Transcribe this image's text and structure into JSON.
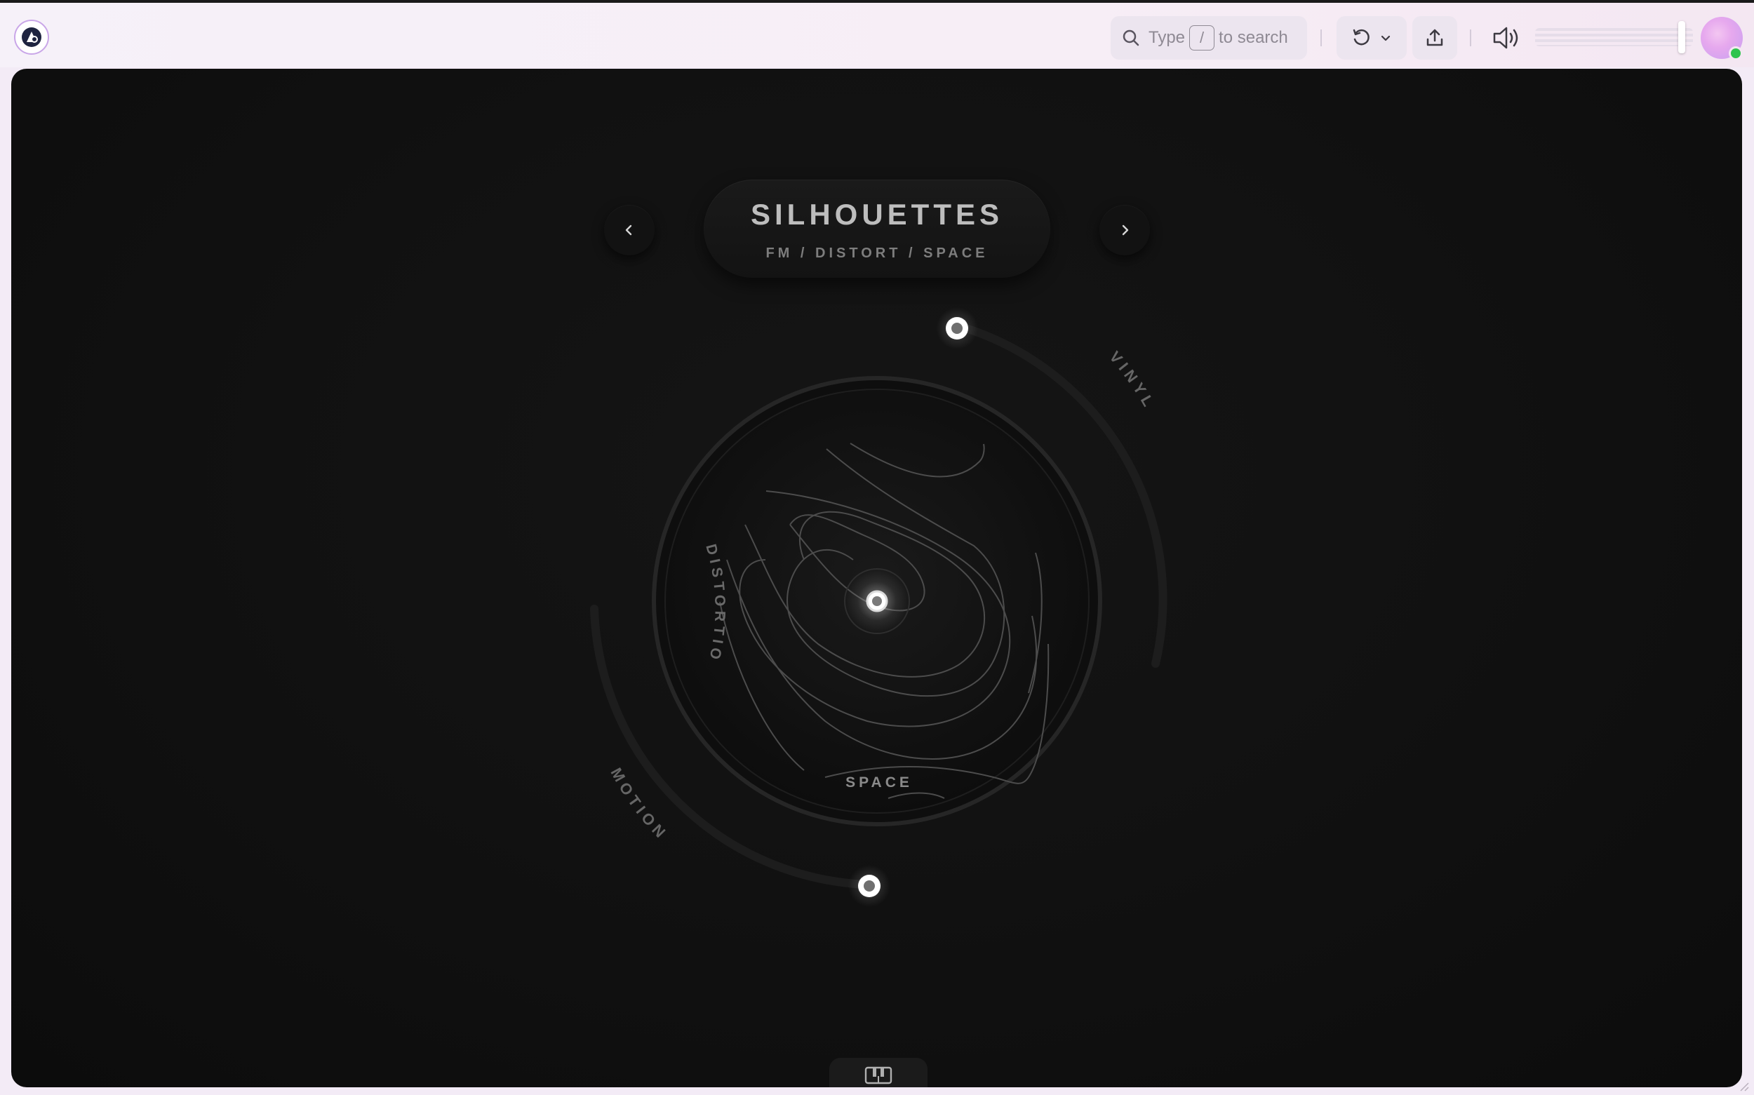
{
  "header": {
    "search": {
      "prefix": "Type",
      "key": "/",
      "suffix": "to search"
    },
    "volume": {
      "level": 0.93
    }
  },
  "preset": {
    "name": "SILHOUETTES",
    "tags": "FM / DISTORT / SPACE"
  },
  "controls": {
    "axis_labels": {
      "vinyl": "VINYL",
      "motion": "MOTION",
      "distortion": "DISTORTION",
      "space": "SPACE"
    }
  },
  "colors": {
    "stage_bg": "#111111",
    "accent": "#ffffff",
    "status_online": "#2ec44d"
  }
}
